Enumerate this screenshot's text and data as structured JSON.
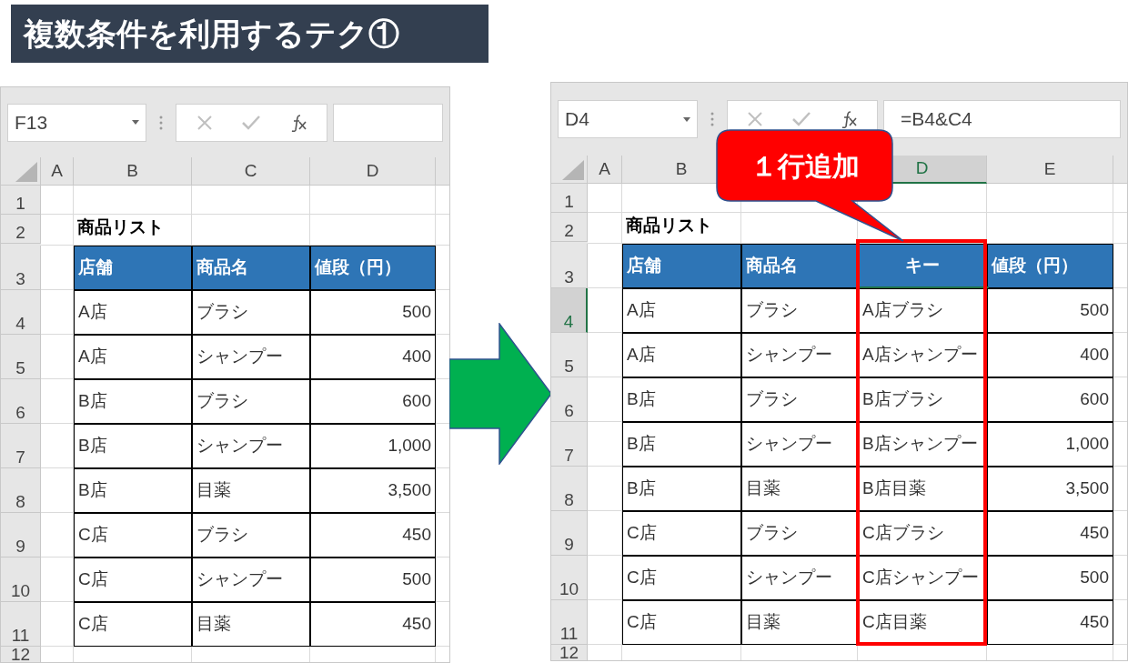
{
  "title": "複数条件を利用するテク①",
  "sheets": [
    {
      "name_box": "F13",
      "columns": [
        {
          "label": "A",
          "selected": false
        },
        {
          "label": "B",
          "selected": false
        },
        {
          "label": "C",
          "selected": false
        },
        {
          "label": "D",
          "selected": false
        }
      ],
      "rows": [
        {
          "label": "1",
          "selected": false
        },
        {
          "label": "2",
          "selected": false
        },
        {
          "label": "3",
          "selected": false
        },
        {
          "label": "4",
          "selected": false
        },
        {
          "label": "5",
          "selected": false
        },
        {
          "label": "6",
          "selected": false
        },
        {
          "label": "7",
          "selected": false
        },
        {
          "label": "8",
          "selected": false
        },
        {
          "label": "9",
          "selected": false
        },
        {
          "label": "10",
          "selected": false
        },
        {
          "label": "11",
          "selected": false
        },
        {
          "label": "12",
          "selected": false
        }
      ],
      "table": {
        "title": "商品リスト",
        "columns": [
          {
            "header": "店舗",
            "kind": "text",
            "highlighted": false
          },
          {
            "header": "商品名",
            "kind": "text",
            "highlighted": false
          },
          {
            "header": "値段（円）",
            "kind": "number",
            "highlighted": false
          }
        ],
        "rows": [
          [
            "A店",
            "ブラシ",
            "500"
          ],
          [
            "A店",
            "シャンプー",
            "400"
          ],
          [
            "B店",
            "ブラシ",
            "600"
          ],
          [
            "B店",
            "シャンプー",
            "1,000"
          ],
          [
            "B店",
            "目薬",
            "3,500"
          ],
          [
            "C店",
            "ブラシ",
            "450"
          ],
          [
            "C店",
            "シャンプー",
            "500"
          ],
          [
            "C店",
            "目薬",
            "450"
          ]
        ]
      }
    },
    {
      "name_box": "D4",
      "formula": "=B4&C4",
      "callout": "１行追加",
      "columns": [
        {
          "label": "A",
          "selected": false
        },
        {
          "label": "B",
          "selected": false
        },
        null,
        {
          "label": "D",
          "selected": true
        },
        {
          "label": "E",
          "selected": false
        }
      ],
      "rows": [
        {
          "label": "1",
          "selected": false
        },
        {
          "label": "2",
          "selected": false
        },
        {
          "label": "3",
          "selected": false
        },
        {
          "label": "4",
          "selected": true
        },
        {
          "label": "5",
          "selected": false
        },
        {
          "label": "6",
          "selected": false
        },
        {
          "label": "7",
          "selected": false
        },
        {
          "label": "8",
          "selected": false
        },
        {
          "label": "9",
          "selected": false
        },
        {
          "label": "10",
          "selected": false
        },
        {
          "label": "11",
          "selected": false
        },
        {
          "label": "12",
          "selected": false
        }
      ],
      "table": {
        "title": "商品リスト",
        "columns": [
          {
            "header": "店舗",
            "kind": "text",
            "highlighted": false
          },
          {
            "header": "商品名",
            "kind": "text",
            "highlighted": false
          },
          {
            "header": "キー",
            "kind": "key",
            "highlighted": true
          },
          {
            "header": "値段（円）",
            "kind": "number",
            "highlighted": false
          }
        ],
        "rows": [
          [
            "A店",
            "ブラシ",
            "A店ブラシ",
            "500"
          ],
          [
            "A店",
            "シャンプー",
            "A店シャンプー",
            "400"
          ],
          [
            "B店",
            "ブラシ",
            "B店ブラシ",
            "600"
          ],
          [
            "B店",
            "シャンプー",
            "B店シャンプー",
            "1,000"
          ],
          [
            "B店",
            "目薬",
            "B店目薬",
            "3,500"
          ],
          [
            "C店",
            "ブラシ",
            "C店ブラシ",
            "450"
          ],
          [
            "C店",
            "シャンプー",
            "C店シャンプー",
            "500"
          ],
          [
            "C店",
            "目薬",
            "C店目薬",
            "450"
          ]
        ]
      }
    }
  ]
}
